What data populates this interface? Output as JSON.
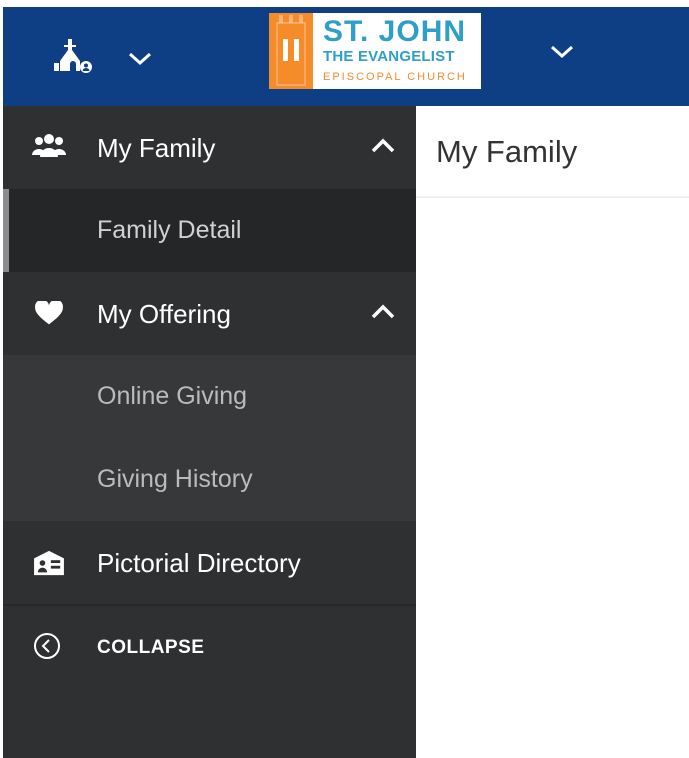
{
  "header": {
    "logo": {
      "line1": "ST. JOHN",
      "line2": "THE EVANGELIST",
      "line3": "EPISCOPAL CHURCH"
    },
    "icons": {
      "church_switcher": "church-user-icon",
      "switcher_chevron": "chevron-down-icon",
      "logo_chevron": "chevron-down-icon"
    }
  },
  "sidebar": {
    "sections": [
      {
        "label": "My Family",
        "icon": "family-icon",
        "expanded": true,
        "items": [
          {
            "label": "Family Detail",
            "active": true
          }
        ]
      },
      {
        "label": "My Offering",
        "icon": "heart-icon",
        "expanded": true,
        "items": [
          {
            "label": "Online Giving",
            "active": false
          },
          {
            "label": "Giving History",
            "active": false
          }
        ]
      },
      {
        "label": "Pictorial Directory",
        "icon": "directory-icon",
        "items": []
      }
    ],
    "collapse_label": "COLLAPSE"
  },
  "content": {
    "title": "My Family"
  },
  "colors": {
    "header_bg": "#0e3f84",
    "sidebar_bg": "#2e3032",
    "submenu_bg": "#363839",
    "active_item_bg": "#242628",
    "logo_blue": "#2f9fc8",
    "logo_orange": "#f68b2a"
  }
}
